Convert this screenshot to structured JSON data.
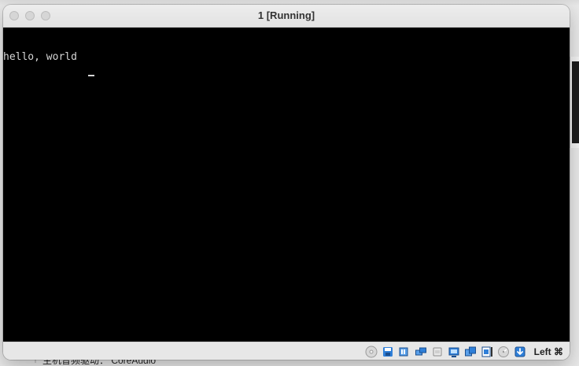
{
  "window": {
    "title": "1 [Running]"
  },
  "console": {
    "line1": "hello, world"
  },
  "statusbar": {
    "icons": [
      "optical-drive-icon",
      "floppy-icon",
      "audio-icon",
      "network-icon",
      "usb-icon",
      "shared-folders-icon",
      "display-icon",
      "recording-icon",
      "cpu-icon",
      "mouse-integration-icon"
    ],
    "host_key_label": "Left ⌘"
  },
  "background": {
    "bottom_text": "主机音频驱动： CoreAudio"
  },
  "colors": {
    "screen_bg": "#000000",
    "console_text": "#d6d6d6",
    "titlebar_bg": "#ececec",
    "status_accent_blue": "#2f7fd8"
  }
}
